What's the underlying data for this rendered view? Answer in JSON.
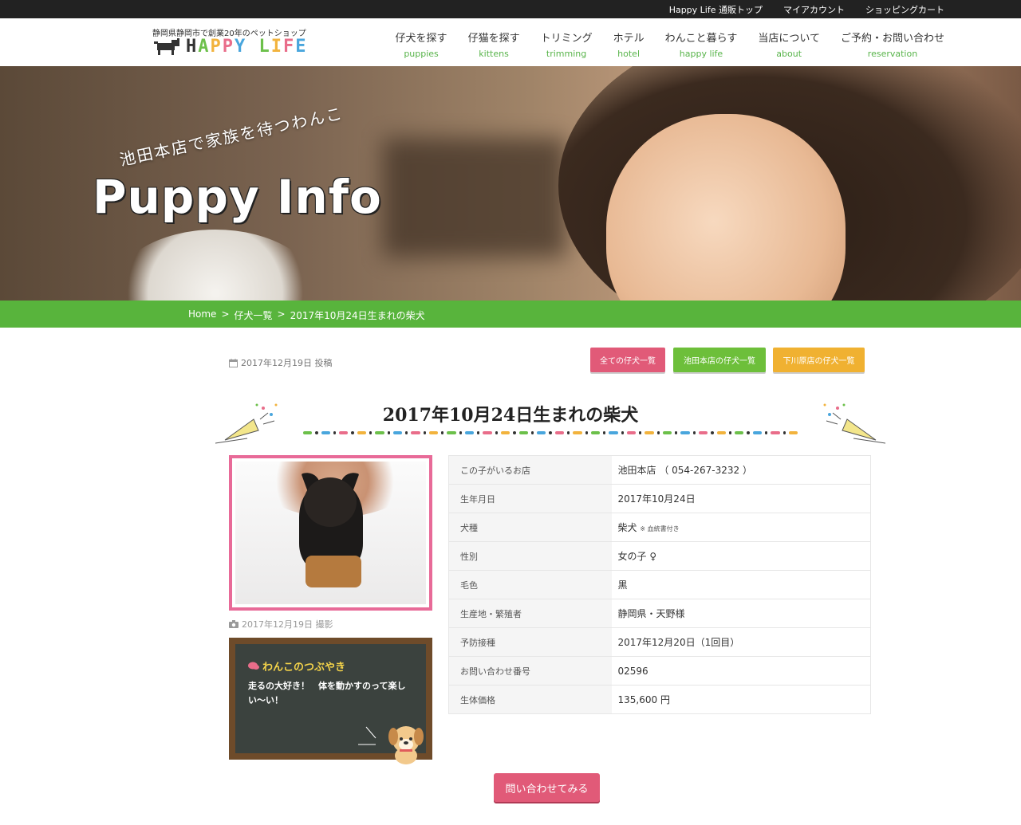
{
  "topbar": {
    "links": [
      "Happy Life 通販トップ",
      "マイアカウント",
      "ショッピングカート"
    ]
  },
  "header": {
    "tagline": "静岡県静岡市で創業20年のペットショップ",
    "logo_text": "HAPPY LIFE",
    "nav": [
      {
        "jp": "仔犬を探す",
        "en": "puppies"
      },
      {
        "jp": "仔猫を探す",
        "en": "kittens"
      },
      {
        "jp": "トリミング",
        "en": "trimming"
      },
      {
        "jp": "ホテル",
        "en": "hotel"
      },
      {
        "jp": "わんこと暮らす",
        "en": "happy life"
      },
      {
        "jp": "当店について",
        "en": "about"
      },
      {
        "jp": "ご予約・お問い合わせ",
        "en": "reservation"
      }
    ]
  },
  "hero": {
    "subtitle": "池田本店で家族を待つわんこ",
    "title": "Puppy Info"
  },
  "breadcrumb": {
    "home": "Home",
    "sep": ">",
    "list": "仔犬一覧",
    "current": "2017年10月24日生まれの柴犬"
  },
  "meta": {
    "posted": "2017年12月19日 投稿",
    "buttons": {
      "all": "全ての仔犬一覧",
      "ikeda": "池田本店の仔犬一覧",
      "shimokawa": "下川原店の仔犬一覧"
    }
  },
  "title": "2017年10月24日生まれの柴犬",
  "photo": {
    "taken": "2017年12月19日 撮影"
  },
  "board": {
    "title": "わんこのつぶやき",
    "text": "走るの大好き！　体を動かすのって楽しい〜い！"
  },
  "info": [
    {
      "label": "この子がいるお店",
      "value": "池田本店 （ 054-267-3232 ）"
    },
    {
      "label": "生年月日",
      "value": "2017年10月24日"
    },
    {
      "label": "犬種",
      "value": "柴犬",
      "note": "※ 血統書付き"
    },
    {
      "label": "性別",
      "value": "女の子 ♀"
    },
    {
      "label": "毛色",
      "value": "黒"
    },
    {
      "label": "生産地・繁殖者",
      "value": "静岡県・天野様"
    },
    {
      "label": "予防接種",
      "value": "2017年12月20日（1回目）"
    },
    {
      "label": "お問い合わせ番号",
      "value": "02596"
    },
    {
      "label": "生体価格",
      "value": "135,600 円"
    }
  ],
  "contact_button": "問い合わせてみる",
  "colors": {
    "green": "#58b43c",
    "pink": "#e15a78",
    "orange": "#f0b131",
    "dark": "#222222"
  }
}
